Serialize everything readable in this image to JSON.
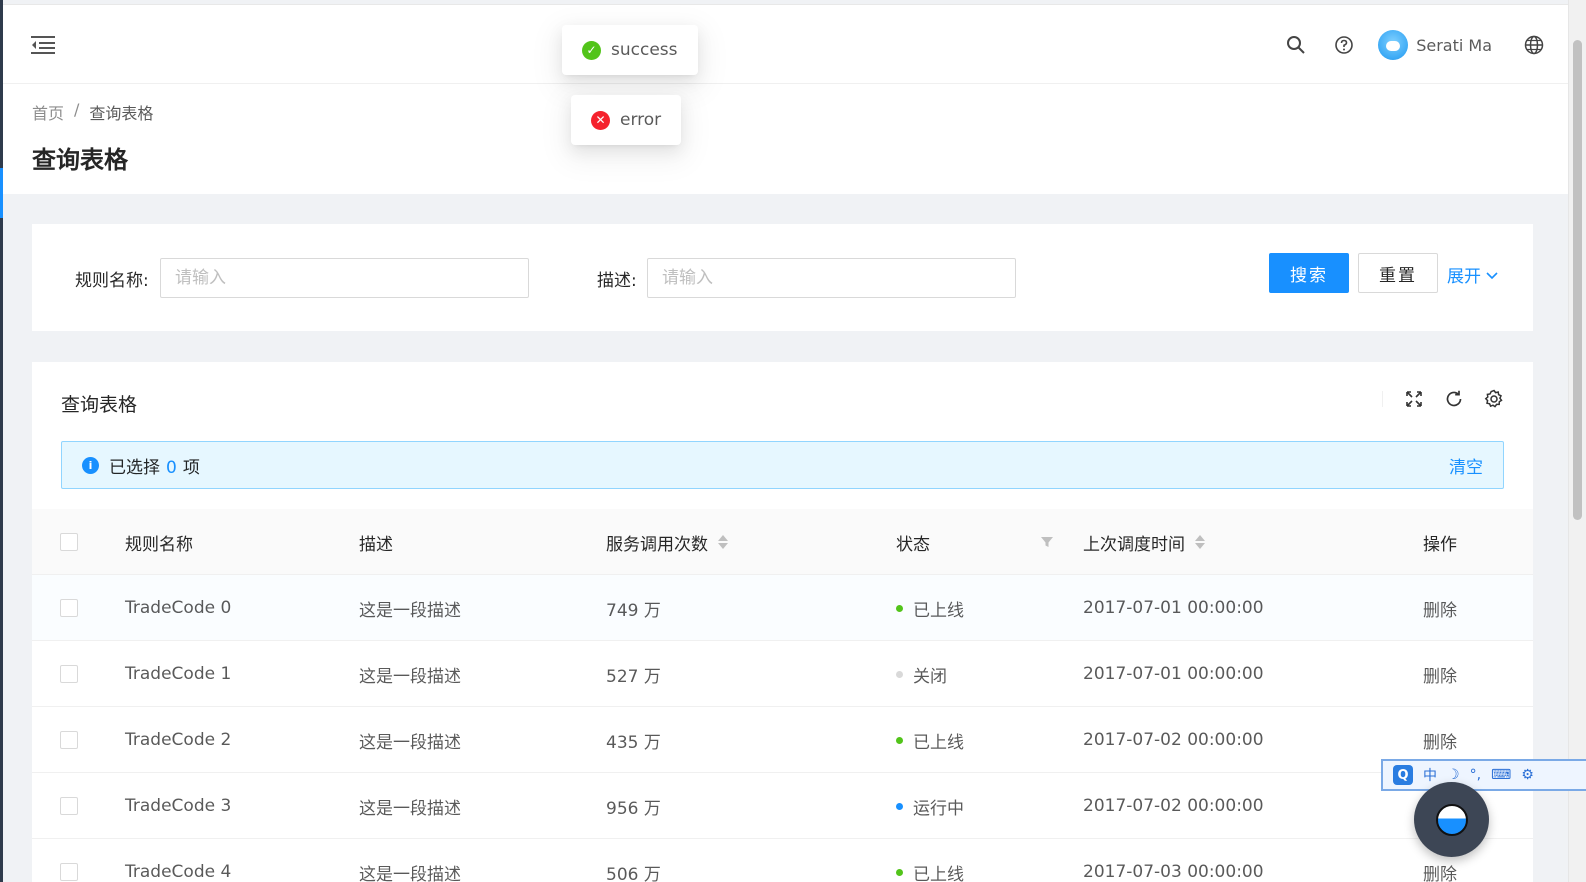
{
  "header": {
    "user_name": "Serati Ma",
    "icons": [
      "menu-fold-icon",
      "search-icon",
      "question-circle-icon",
      "globe-icon"
    ]
  },
  "breadcrumb": {
    "home": "首页",
    "separator": "/",
    "current": "查询表格"
  },
  "page": {
    "title": "查询表格"
  },
  "messages": {
    "success": "success",
    "error": "error"
  },
  "search_form": {
    "rule_name_label": "规则名称:",
    "rule_name_placeholder": "请输入",
    "desc_label": "描述:",
    "desc_placeholder": "请输入",
    "search_button": "搜索",
    "reset_button": "重置",
    "expand_link": "展开"
  },
  "table_card": {
    "title": "查询表格",
    "alert": {
      "prefix": "已选择",
      "count": "0",
      "suffix": "项",
      "clear": "清空"
    },
    "columns": {
      "name": "规则名称",
      "desc": "描述",
      "calls": "服务调用次数",
      "status": "状态",
      "updated": "上次调度时间",
      "action": "操作"
    },
    "rows": [
      {
        "name": "TradeCode 0",
        "desc": "这是一段描述",
        "calls": "749 万",
        "status": "已上线",
        "status_color": "#52c41a",
        "updated": "2017-07-01 00:00:00",
        "action": "删除"
      },
      {
        "name": "TradeCode 1",
        "desc": "这是一段描述",
        "calls": "527 万",
        "status": "关闭",
        "status_color": "#d9d9d9",
        "updated": "2017-07-01 00:00:00",
        "action": "删除"
      },
      {
        "name": "TradeCode 2",
        "desc": "这是一段描述",
        "calls": "435 万",
        "status": "已上线",
        "status_color": "#52c41a",
        "updated": "2017-07-02 00:00:00",
        "action": "删除"
      },
      {
        "name": "TradeCode 3",
        "desc": "这是一段描述",
        "calls": "956 万",
        "status": "运行中",
        "status_color": "#1890ff",
        "updated": "2017-07-02 00:00:00",
        "action": "删除"
      },
      {
        "name": "TradeCode 4",
        "desc": "这是一段描述",
        "calls": "506 万",
        "status": "已上线",
        "status_color": "#52c41a",
        "updated": "2017-07-03 00:00:00",
        "action": "删除"
      }
    ]
  },
  "ime_toolbar": {
    "lang": "中"
  },
  "colors": {
    "primary": "#1890ff",
    "success": "#52c41a",
    "error": "#f5222d"
  }
}
